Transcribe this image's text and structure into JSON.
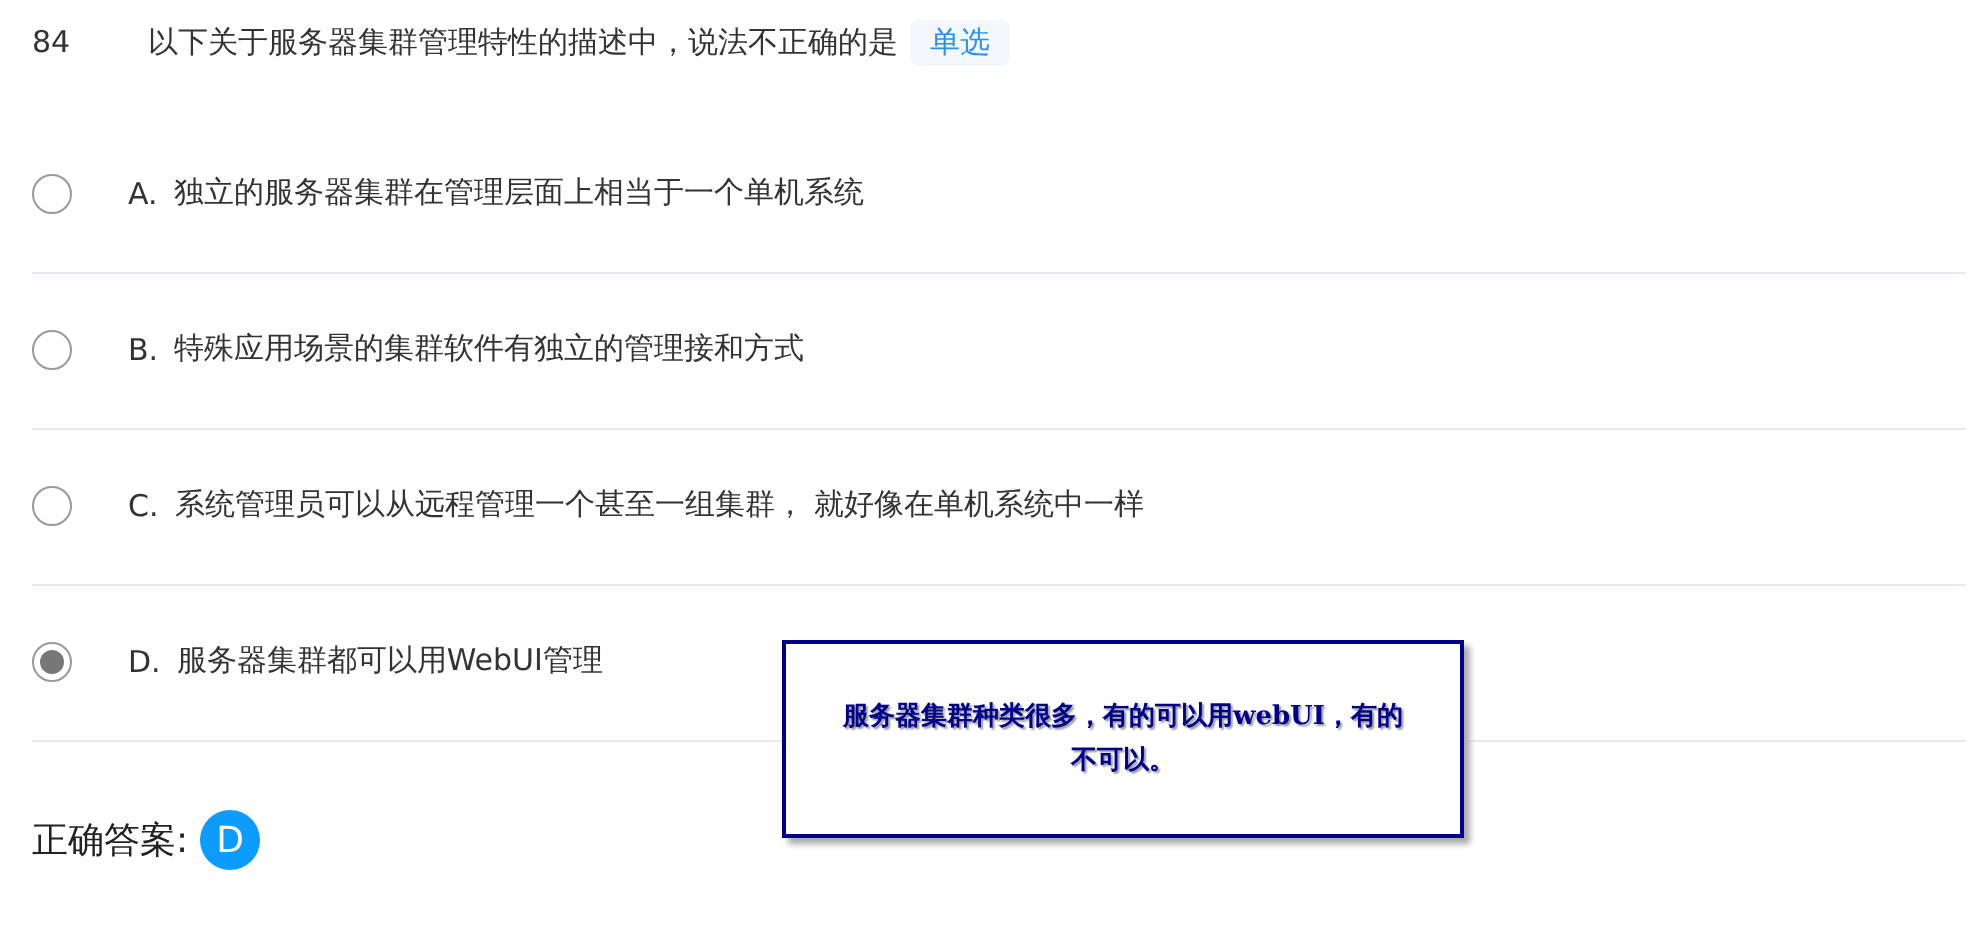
{
  "question": {
    "number": "84",
    "text": "以下关于服务器集群管理特性的描述中，说法不正确的是",
    "type_tag": "单选"
  },
  "options": [
    {
      "letter": "A.",
      "text": "独立的服务器集群在管理层面上相当于一个单机系统",
      "selected": false
    },
    {
      "letter": "B.",
      "text": "特殊应用场景的集群软件有独立的管理接和方式",
      "selected": false
    },
    {
      "letter": "C.",
      "text": "系统管理员可以从远程管理一个甚至一组集群， 就好像在单机系统中一样",
      "selected": false
    },
    {
      "letter": "D.",
      "text": "服务器集群都可以用WebUI管理",
      "selected": true
    }
  ],
  "annotation": {
    "text": "服务器集群种类很多，有的可以用webUI，有的不可以。"
  },
  "answer": {
    "label": "正确答案:",
    "value": "D"
  }
}
